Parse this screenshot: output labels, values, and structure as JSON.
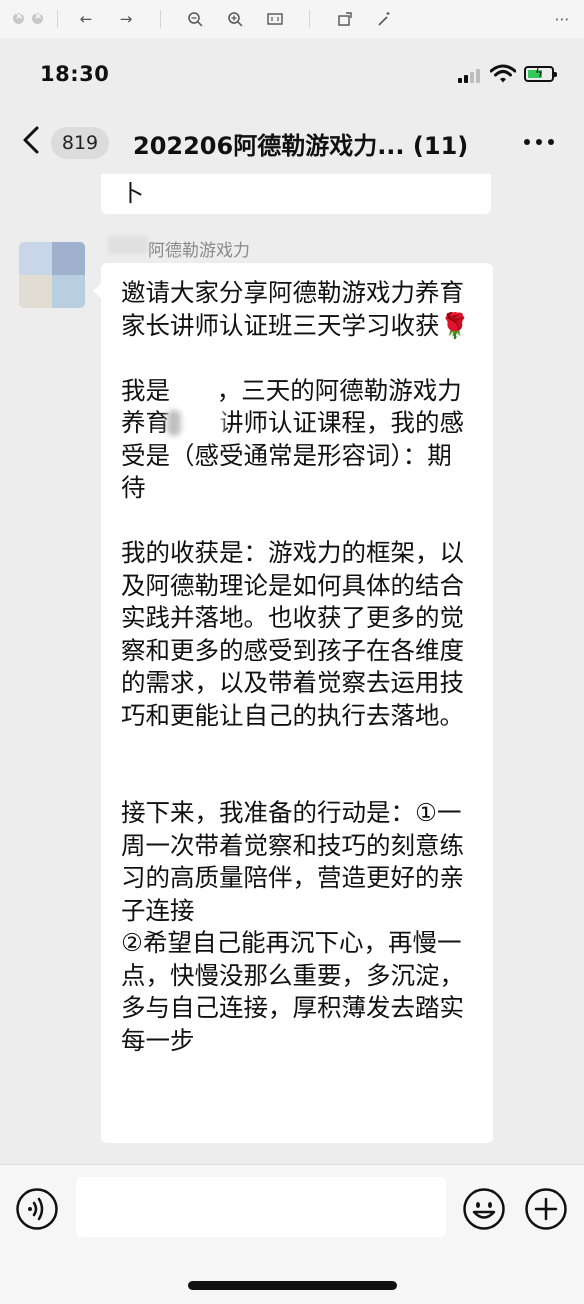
{
  "status_bar": {
    "time": "18:30"
  },
  "nav": {
    "back_count": "819",
    "title": "202206阿德勒游戏力... (11)"
  },
  "chat": {
    "previous_message_tail": "卜",
    "sender_name": "阿德勒游戏力",
    "message": "邀请大家分享阿德勒游戏力养育家长讲师认证班三天学习收获🌹\n\n我是      ，三天的阿德勒游戏力养育家长讲师认证课程，我的感受是（感受通常是形容词）：期待\n\n我的收获是：游戏力的框架，以及阿德勒理论是如何具体的结合实践并落地。也收获了更多的觉察和更多的感受到孩子在各维度的需求，以及带着觉察去运用技巧和更能让自己的执行去落地。\n\n\n接下来，我准备的行动是：①一周一次带着觉察和技巧的刻意练习的高质量陪伴，营造更好的亲子连接\n②希望自己能再沉下心，再慢一点，快慢没那么重要，多沉淀，多与自己连接，厚积薄发去踏实每一步"
  },
  "input_bar": {
    "placeholder": "",
    "icons": [
      "voice-icon",
      "emoji-icon",
      "plus-icon"
    ]
  },
  "viewer_toolbar": {
    "icons": [
      "close-icon",
      "minimize-icon",
      "back-arrow-icon",
      "forward-arrow-icon",
      "zoom-out-icon",
      "zoom-in-icon",
      "fit-icon",
      "rotate-icon",
      "magic-wand-icon",
      "more-icon"
    ]
  },
  "colors": {
    "battery": "#34c759",
    "bubble": "#ffffff",
    "background": "#ededed"
  }
}
